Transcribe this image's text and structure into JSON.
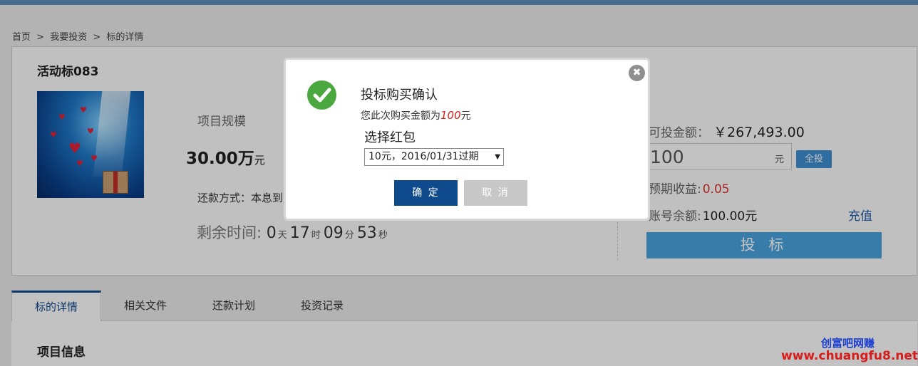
{
  "breadcrumb": {
    "items": [
      "首页",
      ">",
      "我要投资",
      ">",
      "标的详情"
    ]
  },
  "project": {
    "title": "活动标083",
    "scale_label": "项目规模",
    "scale_value": "30.00万",
    "scale_unit": "元",
    "repay_text": "还款方式：本息到",
    "remain_label": "剩余时间:",
    "remain": {
      "days": "0",
      "days_unit": "天",
      "hours": "17",
      "hours_unit": "时",
      "minutes": "09",
      "minutes_unit": "分",
      "seconds": "53",
      "seconds_unit": "秒"
    }
  },
  "invest": {
    "available_label": "可投金额：",
    "available_value": "￥267,493.00",
    "amount_value": "100",
    "amount_unit": "元",
    "allin_label": "全投",
    "expected_label": "预期收益:",
    "expected_value": "0.05",
    "balance_label": "账号余额:",
    "balance_value": "100.00元",
    "recharge_label": "充值",
    "invest_label": "投 标"
  },
  "tabs": [
    {
      "label": "标的详情",
      "active": true
    },
    {
      "label": "相关文件",
      "active": false
    },
    {
      "label": "还款计划",
      "active": false
    },
    {
      "label": "投资记录",
      "active": false
    }
  ],
  "section": {
    "title": "项目信息"
  },
  "watermark": {
    "line1": "创富吧网赚",
    "line2": "www.chuangfu8.net"
  },
  "modal": {
    "title": "投标购买确认",
    "amount_prefix": "您此次购买金额为",
    "amount_value": "100",
    "amount_suffix": "元",
    "redpack_label": "选择红包",
    "redpack_selected": "10元，2016/01/31过期",
    "confirm_label": "确 定",
    "cancel_label": "取 消",
    "close_symbol": "✖"
  },
  "colors": {
    "primary": "#0e4a8c",
    "accent": "#4aa3e0",
    "success": "#4aa83e",
    "danger": "#d81b1b"
  }
}
